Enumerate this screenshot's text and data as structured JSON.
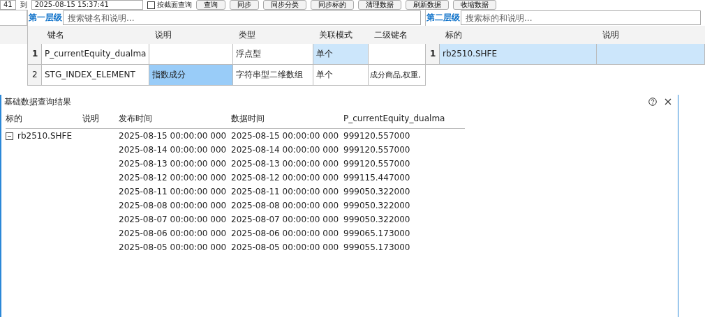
{
  "toolbar": {
    "from_value": "41",
    "to_label": "到",
    "to_value": "2025-08-15 15:37:41",
    "cross_section": {
      "label": "按截面查询",
      "checked": false
    },
    "buttons": [
      "查询",
      "同步",
      "同步分类",
      "同步标的",
      "清理数据",
      "刷新数据",
      "收缩数据"
    ]
  },
  "level1": {
    "label": "第一层级",
    "placeholder": "搜索键名和说明...",
    "columns": [
      "键名",
      "说明",
      "类型",
      "关联模式",
      "二级键名"
    ],
    "rows": [
      {
        "index": "1",
        "bold": true,
        "cells": [
          {
            "text": "P_currentEquity_dualma",
            "selected": false,
            "focused": false
          },
          {
            "text": "",
            "selected": false,
            "focused": false
          },
          {
            "text": "浮点型",
            "selected": false,
            "focused": false
          },
          {
            "text": "单个",
            "selected": false,
            "focused": true
          },
          {
            "text": "",
            "selected": false,
            "focused": false
          }
        ]
      },
      {
        "index": "2",
        "bold": false,
        "cells": [
          {
            "text": "STG_INDEX_ELEMENT",
            "selected": false,
            "focused": false
          },
          {
            "text": "指数成分",
            "selected": true,
            "focused": false
          },
          {
            "text": "字符串型二维数组",
            "selected": false,
            "focused": false
          },
          {
            "text": "单个",
            "selected": false,
            "focused": false
          },
          {
            "text": "成分商品,权重,",
            "selected": false,
            "focused": false
          }
        ]
      }
    ]
  },
  "level2": {
    "label": "第二层级",
    "placeholder": "搜索标的和说明...",
    "columns": [
      "标的",
      "说明"
    ],
    "rows": [
      {
        "index": "1",
        "selected": true,
        "cells": [
          "rb2510.SHFE",
          ""
        ]
      }
    ]
  },
  "dialog": {
    "title": "基础数据查询结果",
    "columns": [
      "标的",
      "说明",
      "发布时间",
      "数据时间",
      "P_currentEquity_dualma"
    ],
    "groups": [
      {
        "label": "rb2510.SHFE",
        "expanded": true,
        "records": [
          [
            "2025-08-15 00:00:00 000",
            "2025-08-15 00:00:00 000",
            "999120.557000"
          ],
          [
            "2025-08-14 00:00:00 000",
            "2025-08-14 00:00:00 000",
            "999120.557000"
          ],
          [
            "2025-08-13 00:00:00 000",
            "2025-08-13 00:00:00 000",
            "999120.557000"
          ],
          [
            "2025-08-12 00:00:00 000",
            "2025-08-12 00:00:00 000",
            "999115.447000"
          ],
          [
            "2025-08-11 00:00:00 000",
            "2025-08-11 00:00:00 000",
            "999050.322000"
          ],
          [
            "2025-08-08 00:00:00 000",
            "2025-08-08 00:00:00 000",
            "999050.322000"
          ],
          [
            "2025-08-07 00:00:00 000",
            "2025-08-07 00:00:00 000",
            "999050.322000"
          ],
          [
            "2025-08-06 00:00:00 000",
            "2025-08-06 00:00:00 000",
            "999065.173000"
          ],
          [
            "2025-08-05 00:00:00 000",
            "2025-08-05 00:00:00 000",
            "999055.173000"
          ]
        ]
      }
    ]
  }
}
